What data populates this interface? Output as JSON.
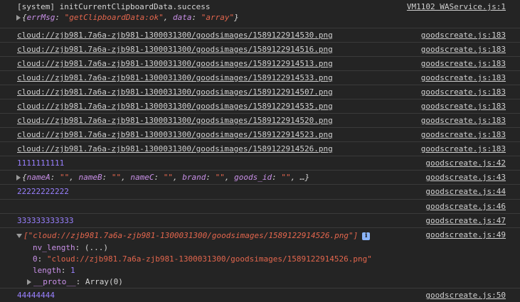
{
  "logs": {
    "system_line": "[system] initCurrentClipboardData.success",
    "system_src": "VM1102 WAService.js:1",
    "system_obj": {
      "open": "{",
      "key1": "errMsg",
      "val1": "\"getClipboardData:ok\"",
      "key2": "data",
      "val2": "\"array\"",
      "close": "}"
    },
    "cloud_rows": [
      {
        "text": "cloud://zjb981.7a6a-zjb981-1300031300/goodsimages/1589122914530.png",
        "src": "goodscreate.js:183"
      },
      {
        "text": "cloud://zjb981.7a6a-zjb981-1300031300/goodsimages/1589122914516.png",
        "src": "goodscreate.js:183"
      },
      {
        "text": "cloud://zjb981.7a6a-zjb981-1300031300/goodsimages/1589122914513.png",
        "src": "goodscreate.js:183"
      },
      {
        "text": "cloud://zjb981.7a6a-zjb981-1300031300/goodsimages/1589122914533.png",
        "src": "goodscreate.js:183"
      },
      {
        "text": "cloud://zjb981.7a6a-zjb981-1300031300/goodsimages/1589122914507.png",
        "src": "goodscreate.js:183"
      },
      {
        "text": "cloud://zjb981.7a6a-zjb981-1300031300/goodsimages/1589122914535.png",
        "src": "goodscreate.js:183"
      },
      {
        "text": "cloud://zjb981.7a6a-zjb981-1300031300/goodsimages/1589122914520.png",
        "src": "goodscreate.js:183"
      },
      {
        "text": "cloud://zjb981.7a6a-zjb981-1300031300/goodsimages/1589122914523.png",
        "src": "goodscreate.js:183"
      },
      {
        "text": "cloud://zjb981.7a6a-zjb981-1300031300/goodsimages/1589122914526.png",
        "src": "goodscreate.js:183"
      }
    ],
    "num1": "1111111111",
    "num1_src": "goodscreate.js:42",
    "obj_line": {
      "open": "{",
      "k1": "nameA",
      "v1": "\"\"",
      "k2": "nameB",
      "v2": "\"\"",
      "k3": "nameC",
      "v3": "\"\"",
      "k4": "brand",
      "v4": "\"\"",
      "k5": "goods_id",
      "v5": "\"\"",
      "tail": ", …}"
    },
    "obj_src": "goodscreate.js:43",
    "num2": "22222222222",
    "num2_src": "goodscreate.js:44",
    "empty_src": "goodscreate.js:46",
    "num3": "333333333333",
    "num3_src": "goodscreate.js:47",
    "array_head": "[\"cloud://zjb981.7a6a-zjb981-1300031300/goodsimages/1589122914526.png\"]",
    "array_src": "goodscreate.js:49",
    "array_props": {
      "nv_key": "nv_length",
      "nv_val": "(...)",
      "idx_key": "0",
      "idx_val": "\"cloud://zjb981.7a6a-zjb981-1300031300/goodsimages/1589122914526.png\"",
      "len_key": "length",
      "len_val": "1",
      "proto_key": "__proto__",
      "proto_val": "Array(0)"
    },
    "info_badge": "i",
    "num4": "44444444",
    "num4_src": "goodscreate.js:50"
  },
  "colors": {
    "background": "#242424",
    "number_log": "#9980ff",
    "string": "#f28b54",
    "key": "#c990e8"
  }
}
